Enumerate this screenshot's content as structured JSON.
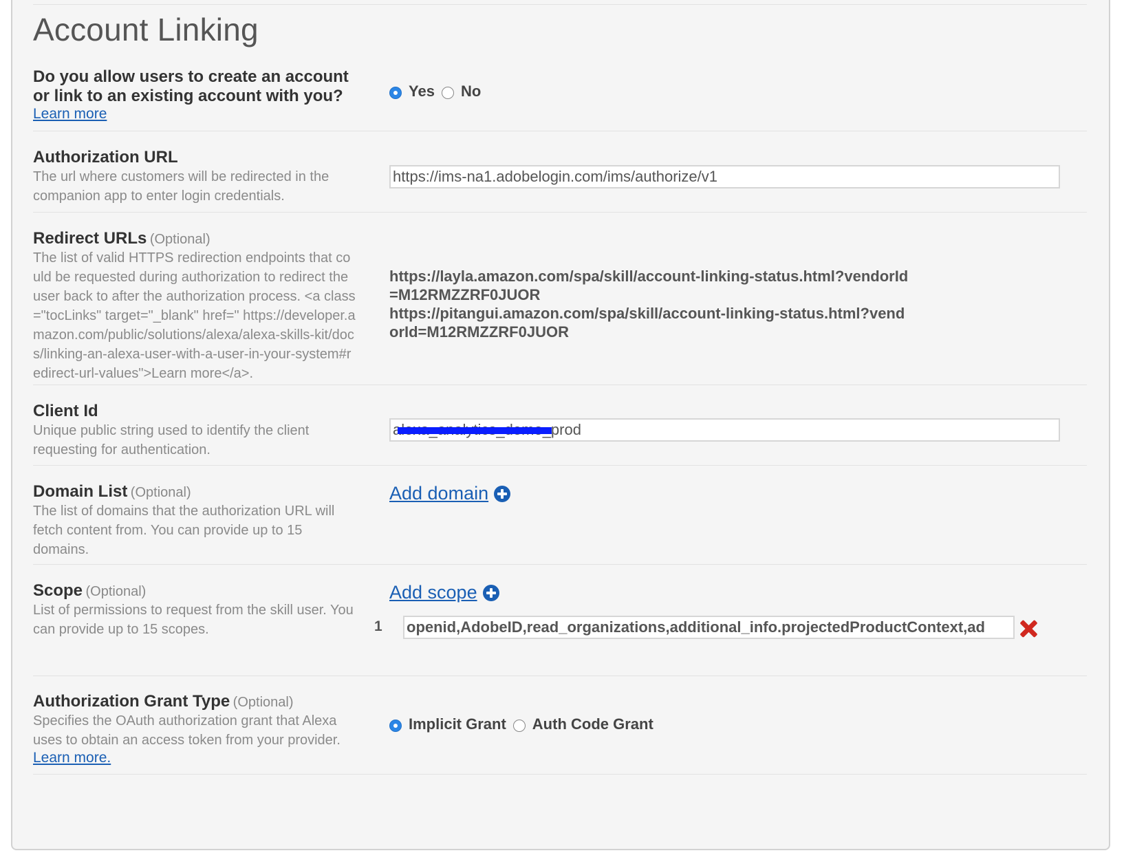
{
  "title": "Account Linking",
  "account_linking_question": {
    "label": "Do you allow users to create an account or link to an existing account with you?",
    "learn_more": "Learn more",
    "options": [
      {
        "label": "Yes",
        "checked": true
      },
      {
        "label": "No",
        "checked": false
      }
    ]
  },
  "authorization_url": {
    "label": "Authorization URL",
    "description": "The url where customers will be redirected in the companion app to enter login credentials.",
    "value": "https://ims-na1.adobelogin.com/ims/authorize/v1"
  },
  "redirect_urls": {
    "label": "Redirect URLs",
    "optional": "(Optional)",
    "description": "The list of valid HTTPS redirection endpoints that could be requested during authorization to redirect the user back to after the authorization process. <a class=\"tocLinks\" target=\"_blank\" href=\" https://developer.amazon.com/public/solutions/alexa/alexa-skills-kit/docs/linking-an-alexa-user-with-a-user-in-your-system#redirect-url-values\">Learn more</a>.",
    "urls": [
      "https://layla.amazon.com/spa/skill/account-linking-status.html?vendorId=M12RMZZRF0JUOR",
      "https://pitangui.amazon.com/spa/skill/account-linking-status.html?vendorId=M12RMZZRF0JUOR"
    ]
  },
  "client_id": {
    "label": "Client Id",
    "description": "Unique public string used to identify the client requesting for authentication.",
    "value": "alexa_analytics_demo_prod"
  },
  "domain_list": {
    "label": "Domain List",
    "optional": "(Optional)",
    "description": "The list of domains that the authorization URL will fetch content from. You can provide up to 15 domains.",
    "add_label": "Add domain"
  },
  "scope": {
    "label": "Scope",
    "optional": "(Optional)",
    "description": "List of permissions to request from the skill user. You can provide up to 15 scopes.",
    "add_label": "Add scope",
    "items": [
      {
        "index": "1",
        "value": "openid,AdobeID,read_organizations,additional_info.projectedProductContext,ad"
      }
    ]
  },
  "grant_type": {
    "label": "Authorization Grant Type",
    "optional": "(Optional)",
    "description": "Specifies the OAuth authorization grant that Alexa uses to obtain an access token from your provider.",
    "learn_more": "Learn more.",
    "options": [
      {
        "label": "Implicit Grant",
        "checked": true
      },
      {
        "label": "Auth Code Grant",
        "checked": false
      }
    ]
  },
  "colors": {
    "panel_background": "#f5f5f5",
    "link": "#1a5fb4",
    "radio_checked": "#2b86e6",
    "delete": "#d0281f",
    "redaction": "#0a1eff"
  }
}
